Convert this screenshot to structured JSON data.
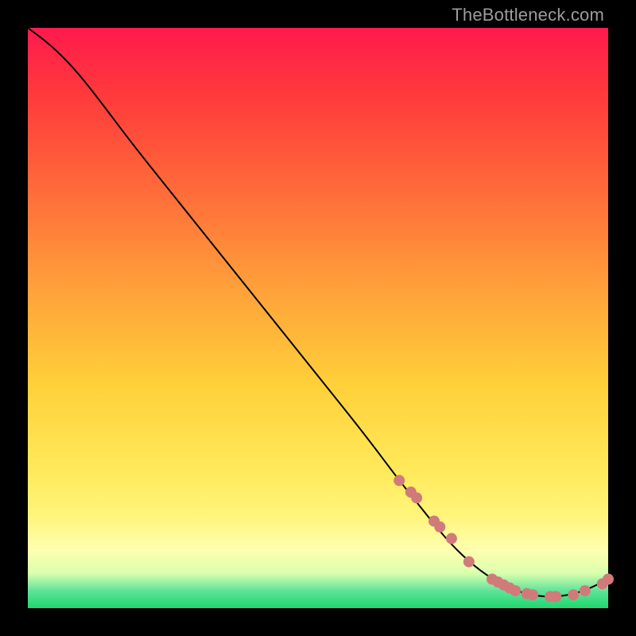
{
  "watermark": "TheBottleneck.com",
  "colors": {
    "dot": "#d17a7a",
    "line": "#000000"
  },
  "chart_data": {
    "type": "line",
    "title": "",
    "xlabel": "",
    "ylabel": "",
    "xlim": [
      0,
      100
    ],
    "ylim": [
      0,
      100
    ],
    "grid": false,
    "series": [
      {
        "name": "bottleneck-curve",
        "x": [
          0,
          4,
          8,
          12,
          18,
          26,
          34,
          42,
          50,
          58,
          64,
          68,
          72,
          76,
          80,
          84,
          88,
          92,
          96,
          100
        ],
        "y": [
          100,
          97,
          93,
          88,
          80,
          70,
          60,
          50,
          40,
          30,
          22,
          17,
          12,
          8,
          5,
          3,
          2,
          2,
          3,
          5
        ]
      }
    ],
    "markers": {
      "name": "highlight-points",
      "x": [
        64,
        66,
        67,
        70,
        71,
        73,
        76,
        80,
        81,
        82,
        83,
        84,
        86,
        87,
        90,
        91,
        94,
        96,
        99,
        100
      ],
      "y": [
        22,
        20,
        19,
        15,
        14,
        12,
        8,
        5,
        4.5,
        4,
        3.5,
        3,
        2.5,
        2.3,
        2,
        2,
        2.3,
        3,
        4.2,
        5
      ]
    }
  }
}
